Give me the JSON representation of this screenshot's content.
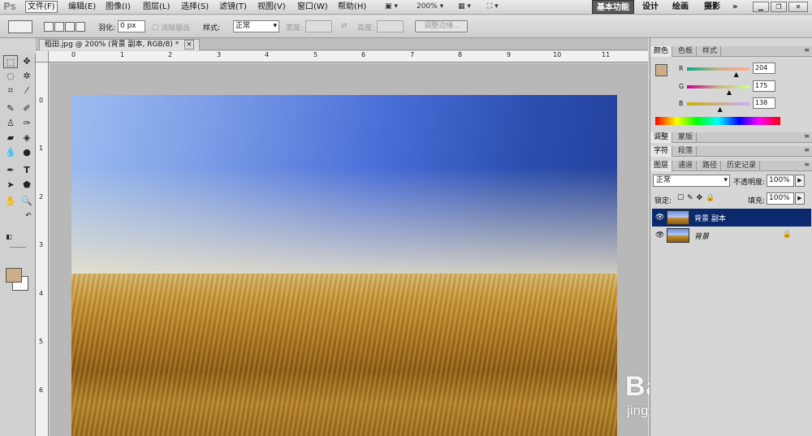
{
  "app": {
    "logo": "Ps"
  },
  "menu": [
    "文件(F)",
    "编辑(E)",
    "图像(I)",
    "图层(L)",
    "选择(S)",
    "滤镜(T)",
    "视图(V)",
    "窗口(W)",
    "帮助(H)"
  ],
  "zoom_ctl": "200%",
  "workspaces": {
    "active": "基本功能",
    "items": [
      "设计",
      "绘画",
      "摄影"
    ],
    "more": "»"
  },
  "options": {
    "feather_label": "羽化:",
    "feather_value": "0 px",
    "antialias_label": "消除锯齿",
    "style_label": "样式:",
    "style_value": "正常",
    "width_label": "宽度:",
    "height_label": "高度:",
    "refine_button": "调整边缘..."
  },
  "document": {
    "tab_title": "稻田.jpg @ 200% (背景 副本, RGB/8) *",
    "close": "×"
  },
  "ruler": {
    "top": [
      "0",
      "1",
      "2",
      "3",
      "4",
      "5",
      "6",
      "7",
      "8",
      "9",
      "10",
      "11"
    ],
    "left": [
      "0",
      "1",
      "2",
      "3",
      "4",
      "5",
      "6"
    ]
  },
  "color_panel": {
    "tabs": [
      "颜色",
      "色板",
      "样式"
    ],
    "r_label": "R",
    "g_label": "G",
    "b_label": "B",
    "r": "204",
    "g": "175",
    "b": "138",
    "r_level": 0.8,
    "g_level": 0.686,
    "b_level": 0.541
  },
  "adjust_panel": {
    "tabs": [
      "调整",
      "蒙版"
    ]
  },
  "char_panel": {
    "tabs": [
      "字符",
      "段落"
    ]
  },
  "layers_panel": {
    "tabs": [
      "图层",
      "通道",
      "路径",
      "历史记录"
    ],
    "blend_mode": "正常",
    "opacity_label": "不透明度:",
    "opacity": "100%",
    "lock_label": "锁定:",
    "fill_label": "填充:",
    "fill": "100%",
    "layers": [
      {
        "name": "背景 副本",
        "selected": true
      },
      {
        "name": "背景",
        "selected": false
      }
    ]
  },
  "watermark": {
    "logo": "Bai du 经验",
    "url": "jingyan.baidu.com"
  },
  "colors": {
    "foreground": "#ccaf8a",
    "selected_layer": "#0b2a6e"
  }
}
